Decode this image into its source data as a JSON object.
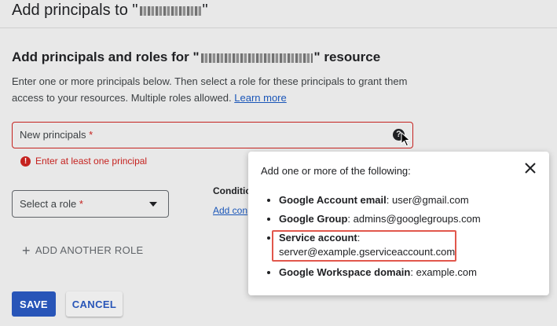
{
  "header": {
    "title_prefix": "Add principals to \"",
    "title_suffix": "\""
  },
  "section": {
    "title_prefix": "Add principals and roles for \"",
    "title_suffix": "\" resource",
    "description": "Enter one or more principals below. Then select a role for these principals to grant them access to your resources. Multiple roles allowed.",
    "learn_more": "Learn more"
  },
  "principals_field": {
    "label": "New principals",
    "required_mark": "*",
    "help_icon": "question-circle-icon",
    "error": "Enter at least one principal"
  },
  "role_select": {
    "label": "Select a role",
    "required_mark": "*"
  },
  "condition": {
    "heading": "Conditio",
    "link": "Add con"
  },
  "add_role_button": "ADD ANOTHER ROLE",
  "actions": {
    "save": "SAVE",
    "cancel": "CANCEL"
  },
  "tooltip": {
    "title": "Add one or more of the following:",
    "items": [
      {
        "term": "Google Account email",
        "value": "user@gmail.com"
      },
      {
        "term": "Google Group",
        "value": "admins@googlegroups.com"
      },
      {
        "term": "Service account",
        "value": "server@example.gserviceaccount.com"
      },
      {
        "term": "Google Workspace domain",
        "value": "example.com"
      }
    ]
  },
  "colors": {
    "accent": "#2855b8",
    "error": "#c5221f",
    "highlight": "#e1574c"
  }
}
